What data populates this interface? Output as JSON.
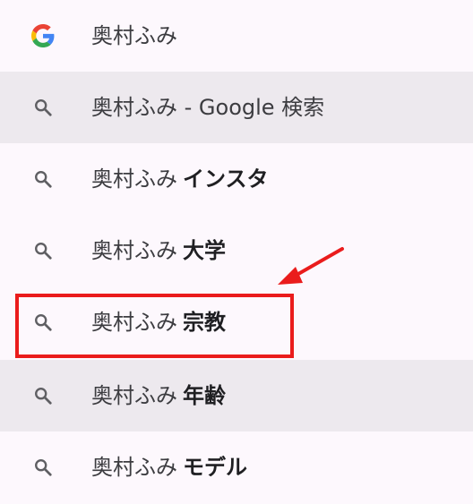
{
  "suggestions": [
    {
      "icon": "google-g-icon",
      "query": "奥村ふみ",
      "suffix": "",
      "highlighted": false
    },
    {
      "icon": "search-icon",
      "query": "奥村ふみ - Google 検索",
      "suffix": "",
      "highlighted": true
    },
    {
      "icon": "search-icon",
      "query": "奥村ふみ",
      "suffix": "インスタ",
      "highlighted": false
    },
    {
      "icon": "search-icon",
      "query": "奥村ふみ",
      "suffix": "大学",
      "highlighted": false
    },
    {
      "icon": "search-icon",
      "query": "奥村ふみ",
      "suffix": "宗教",
      "highlighted": false
    },
    {
      "icon": "search-icon",
      "query": "奥村ふみ",
      "suffix": "年齢",
      "highlighted": true
    },
    {
      "icon": "search-icon",
      "query": "奥村ふみ",
      "suffix": "モデル",
      "highlighted": false
    }
  ],
  "colors": {
    "background": "#fdf8fd",
    "highlight": "#ede9ee",
    "annotation": "#ea1c1c",
    "google_blue": "#4285F4",
    "google_red": "#EA4335",
    "google_yellow": "#FBBC05",
    "google_green": "#34A853"
  }
}
